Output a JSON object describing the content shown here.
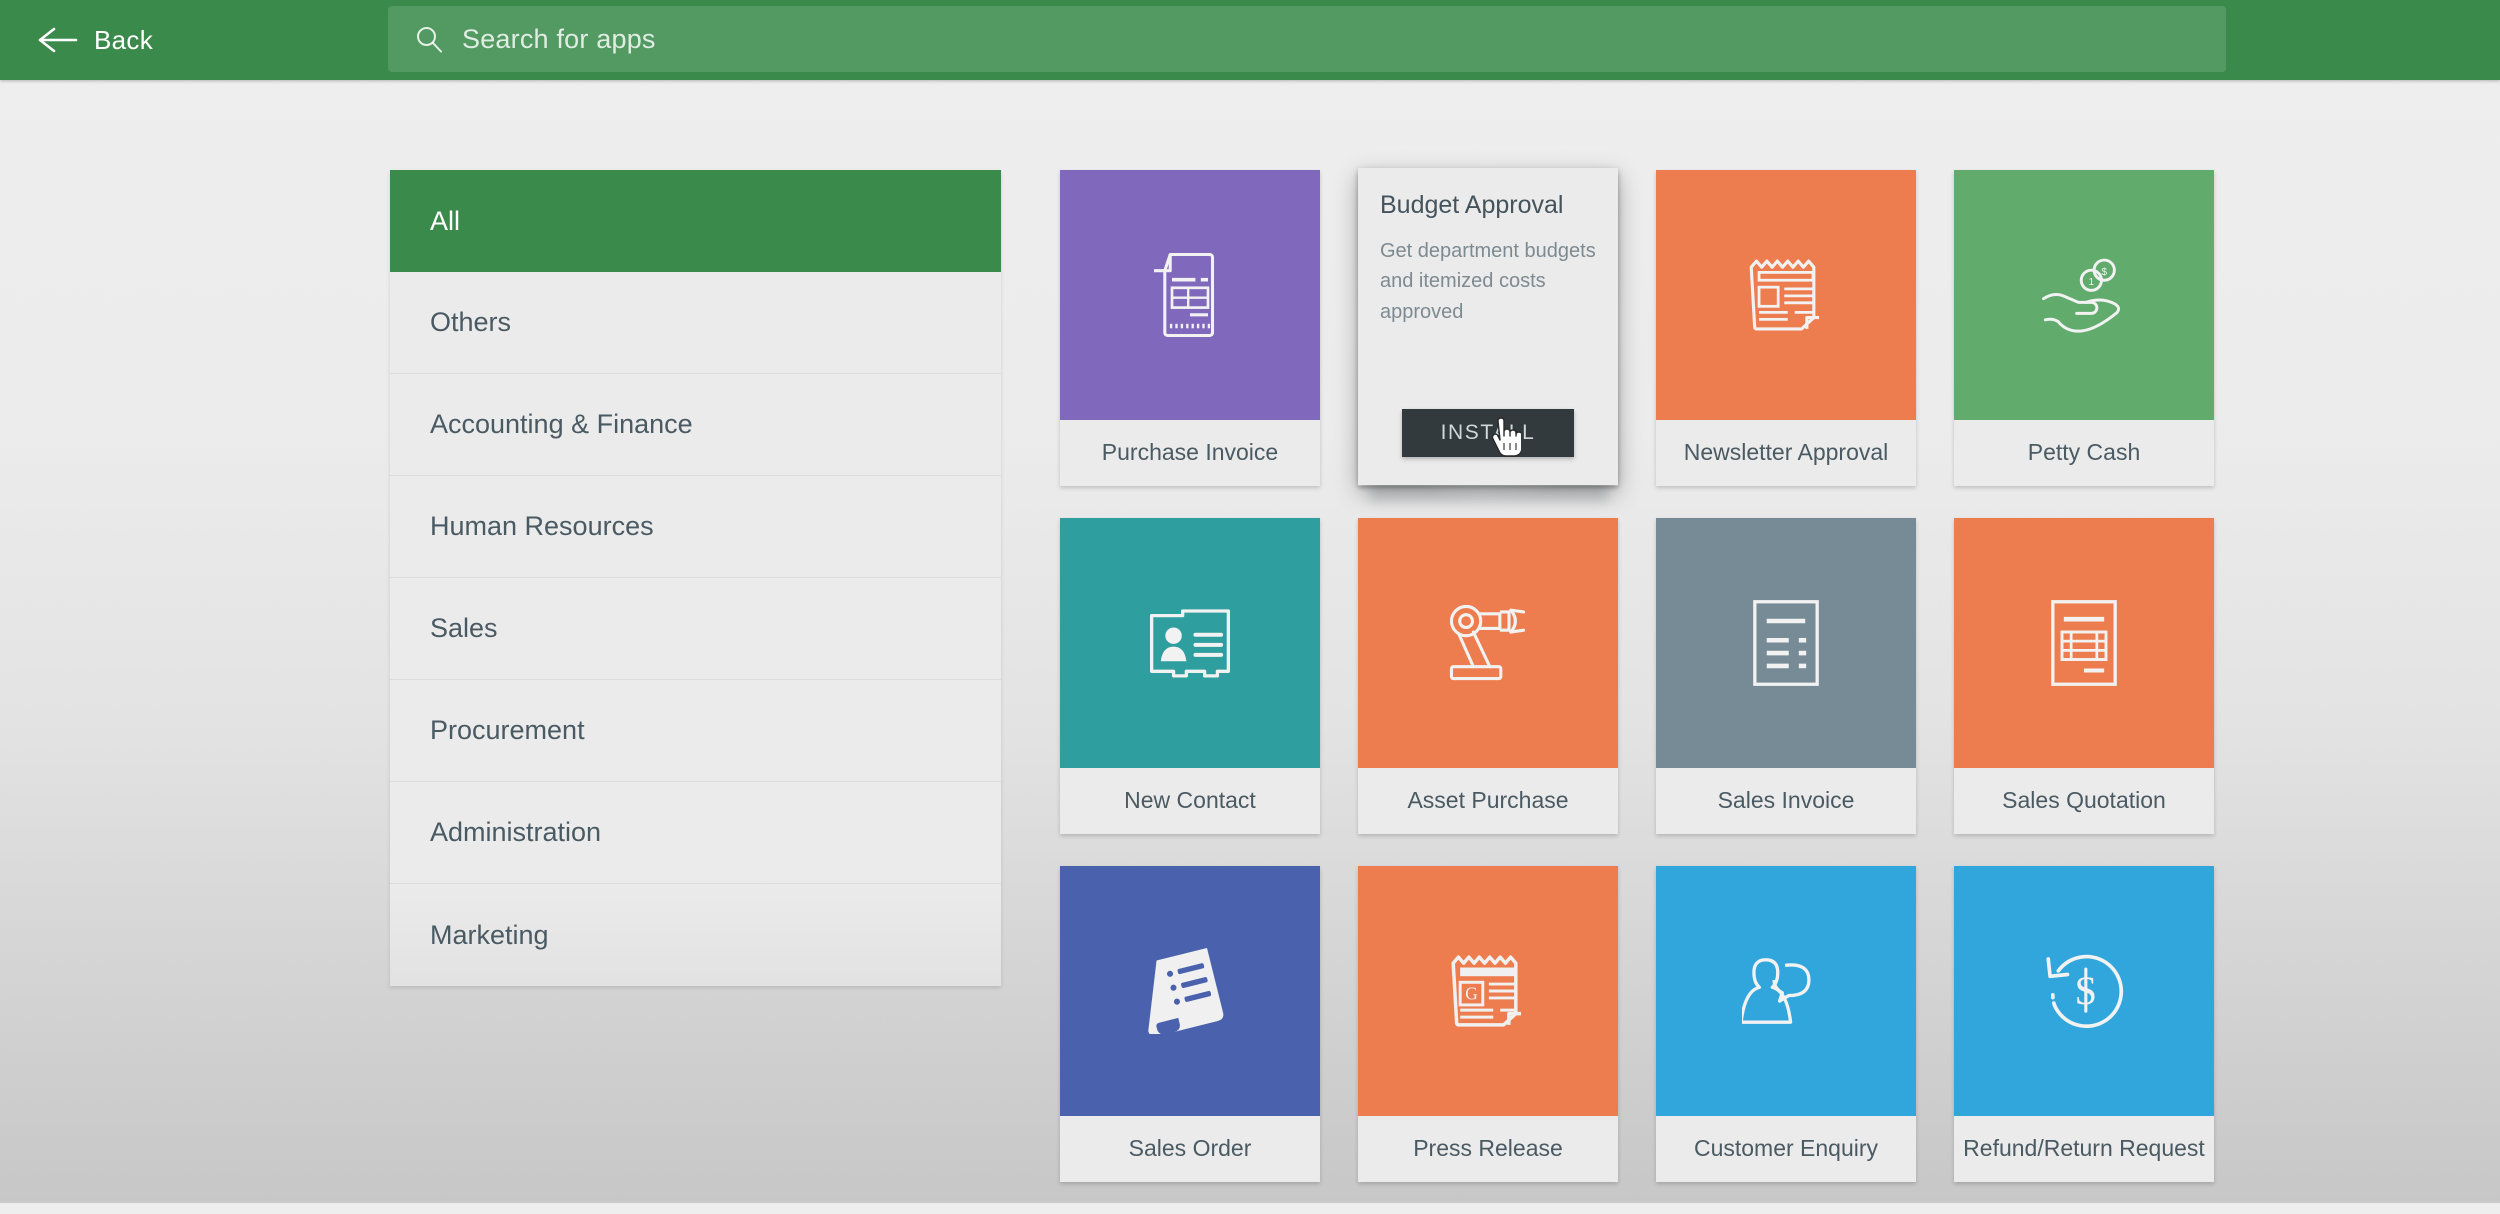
{
  "topbar": {
    "back_label": "Back",
    "back_icon": "arrow-left-icon",
    "search_placeholder": "Search for apps",
    "search_value": "",
    "search_icon": "search-icon",
    "bar_color": "#3a8a4b"
  },
  "sidebar": {
    "items": [
      {
        "label": "All",
        "active": true
      },
      {
        "label": "Others",
        "active": false
      },
      {
        "label": "Accounting & Finance",
        "active": false
      },
      {
        "label": "Human Resources",
        "active": false
      },
      {
        "label": "Sales",
        "active": false
      },
      {
        "label": "Procurement",
        "active": false
      },
      {
        "label": "Administration",
        "active": false
      },
      {
        "label": "Marketing",
        "active": false
      }
    ],
    "active_color": "#3a8a4b",
    "item_bg": "#ebebeb",
    "text_color": "#4a5a63"
  },
  "apps": [
    {
      "label": "Purchase Invoice",
      "color": "#8068bd",
      "icon": "invoice-document-icon"
    },
    {
      "label": "Budget Approval",
      "color": "#8068bd",
      "icon": "budget-icon",
      "hovered": true
    },
    {
      "label": "Newsletter Approval",
      "color": "#ed7d4e",
      "icon": "newspaper-icon"
    },
    {
      "label": "Petty Cash",
      "color": "#61ab6d",
      "icon": "hand-coins-icon"
    },
    {
      "label": "New Contact",
      "color": "#2e9e9e",
      "icon": "contact-card-icon"
    },
    {
      "label": "Asset Purchase",
      "color": "#ed7d4e",
      "icon": "robot-arm-icon"
    },
    {
      "label": "Sales Invoice",
      "color": "#768b96",
      "icon": "document-lines-icon"
    },
    {
      "label": "Sales Quotation",
      "color": "#ed7d4e",
      "icon": "quotation-table-icon"
    },
    {
      "label": "Sales Order",
      "color": "#4a62ae",
      "icon": "tilted-list-icon"
    },
    {
      "label": "Press Release",
      "color": "#ed7d4e",
      "icon": "press-newspaper-icon"
    },
    {
      "label": "Customer Enquiry",
      "color": "#31a6dd",
      "icon": "person-speech-icon"
    },
    {
      "label": "Refund/Return Request",
      "color": "#31a6dd",
      "icon": "refund-dollar-icon"
    }
  ],
  "hover_card": {
    "title": "Budget Approval",
    "description": "Get department budgets and itemized costs approved",
    "install_label": "INSTALL",
    "install_bg": "#333a3d"
  },
  "cursor": {
    "type": "pointing-hand-cursor"
  }
}
